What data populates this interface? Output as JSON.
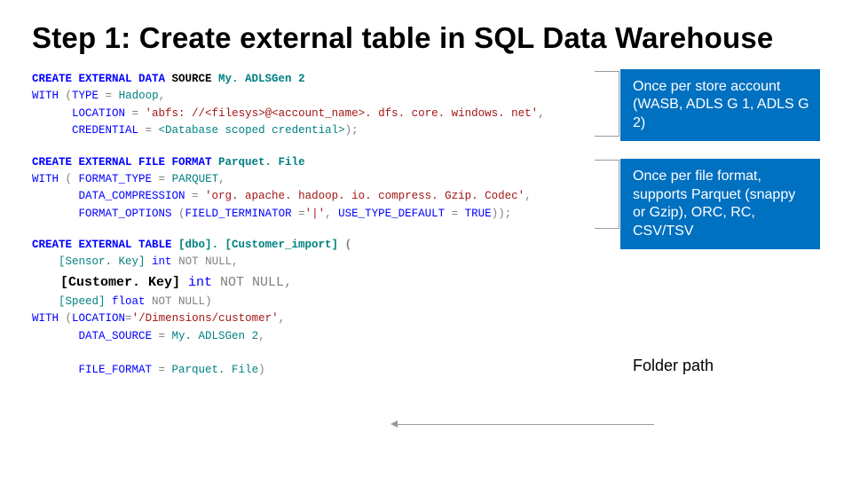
{
  "title": "Step 1: Create external table in SQL Data Warehouse",
  "code": {
    "block1": {
      "l1_kw": "CREATE EXTERNAL DATA ",
      "l1_src": "SOURCE",
      "l1_name": " My. ADLSGen 2",
      "l2_pre": "WITH ",
      "l2_open": "(",
      "l2_type": "TYPE ",
      "l2_eq": "=",
      "l2_val": " Hadoop",
      "l2_comma": ",",
      "l3_indent": "      LOCATION ",
      "l3_eq": "=",
      "l3_val": " 'abfs: //<filesys>@<account_name>. dfs. core. windows. net'",
      "l3_comma": ",",
      "l4_indent": "      CREDENTIAL ",
      "l4_eq": "=",
      "l4_val": " <Database scoped credential>",
      "l4_close": ");"
    },
    "block2": {
      "l1_kw": "CREATE EXTERNAL FILE ",
      "l1_fmt": "FORMAT",
      "l1_name": " Parquet. File",
      "l2_pre": "WITH ",
      "l2_open": "( ",
      "l2_ft": "FORMAT_TYPE ",
      "l2_eq": "=",
      "l2_val": " PARQUET",
      "l2_comma": ",",
      "l3_indent": "       DATA_COMPRESSION ",
      "l3_eq": "=",
      "l3_val": " 'org. apache. hadoop. io. compress. Gzip. Codec'",
      "l3_comma": ",",
      "l4_indent": "       FORMAT_OPTIONS ",
      "l4_open": "(",
      "l4_ft": "FIELD_TERMINATOR ",
      "l4_eq": "=",
      "l4_v1": "'|'",
      "l4_comma": ", ",
      "l4_utd": "USE_TYPE_DEFAULT ",
      "l4_eq2": "=",
      "l4_true": " TRUE",
      "l4_close": "));"
    },
    "block3": {
      "l1_kw": "CREATE EXTERNAL TABLE ",
      "l1_name": "[dbo]. [Customer_import] ",
      "l1_open": "(",
      "l2_indent": "    ",
      "l2_field": "[Sensor. Key] ",
      "l2_type": "int ",
      "l2_nn": "NOT NULL",
      "l2_comma": ",",
      "ck_field": "[Customer. Key]",
      "ck_type": " int ",
      "ck_nn": "NOT NULL",
      "ck_comma": ",",
      "l4_indent": "    ",
      "l4_field": "[Speed] ",
      "l4_type": "float ",
      "l4_nn": "NOT NULL",
      "l4_close": ")",
      "l5_pre": "WITH ",
      "l5_open": "(",
      "l5_loc": "LOCATION",
      "l5_eq": "=",
      "l5_val": "'/Dimensions/customer'",
      "l5_comma": ",",
      "l6_indent": "       DATA_SOURCE ",
      "l6_eq": "=",
      "l6_val": " My. ADLSGen 2",
      "l6_comma": ",",
      "l7_indent": "       FILE_FORMAT ",
      "l7_eq": "=",
      "l7_val": " Parquet. File",
      "l7_close": ")"
    }
  },
  "callouts": {
    "c1": "Once per store account (WASB, ADLS G 1, ADLS G 2)",
    "c2": "Once per file format, supports Parquet (snappy or Gzip), ORC, RC, CSV/TSV",
    "c3": "Folder path"
  }
}
